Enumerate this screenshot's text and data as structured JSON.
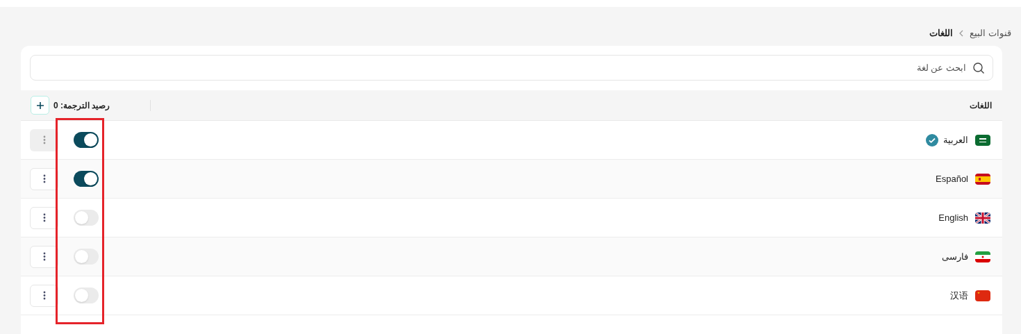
{
  "breadcrumb": [
    {
      "label": "قنوات البيع",
      "current": false
    },
    {
      "label": "اللغات",
      "current": true
    }
  ],
  "search": {
    "placeholder": "ابحث عن لغة"
  },
  "table": {
    "column_heading": "اللغات",
    "balance": "رصيد الترجمة: 0"
  },
  "toggle_column_highlighted": true,
  "languages": [
    {
      "name": "العربية",
      "kind": "sa",
      "default": true,
      "on": true,
      "menu_disabled": true
    },
    {
      "name": "Español",
      "kind": "es",
      "default": false,
      "on": true,
      "menu_disabled": false
    },
    {
      "name": "English",
      "kind": "gb",
      "default": false,
      "on": false,
      "menu_disabled": false
    },
    {
      "name": "فارسی",
      "kind": "ir",
      "default": false,
      "on": false,
      "menu_disabled": false
    },
    {
      "name": "汉语",
      "kind": "cn",
      "default": false,
      "on": false,
      "menu_disabled": false
    }
  ]
}
